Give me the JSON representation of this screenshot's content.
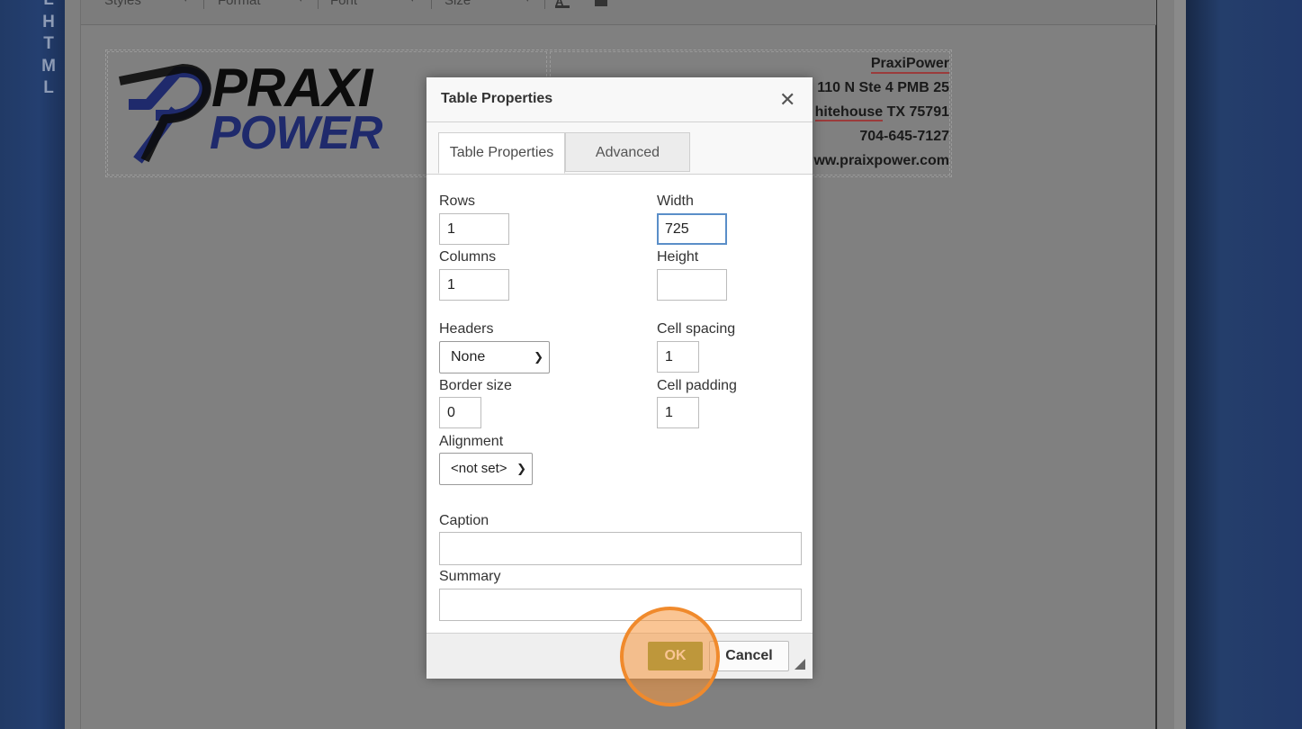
{
  "left_panel": {
    "vertical_label": [
      "L",
      " ",
      "H",
      "T",
      "M",
      "L"
    ]
  },
  "toolbar": {
    "styles_label": "Styles",
    "format_label": "Format",
    "font_label": "Font",
    "size_label": "Size",
    "text_color_icon": "text-color-icon",
    "bg_color_icon": "background-color-icon"
  },
  "document": {
    "logo_top": "PRAXI",
    "logo_bottom": "POWER",
    "company_name": "PraxiPower",
    "address_line": "110 N Ste 4 PMB 25",
    "city_line_city": "hitehouse",
    "city_line_rest": " TX 75791",
    "phone": "704-645-7127",
    "website": "ww.praixpower.com"
  },
  "dialog": {
    "title": "Table Properties",
    "close_icon": "close-icon",
    "tabs": [
      {
        "label": "Table Properties",
        "active": true
      },
      {
        "label": "Advanced",
        "active": false
      }
    ],
    "fields": {
      "rows_label": "Rows",
      "rows_value": "1",
      "columns_label": "Columns",
      "columns_value": "1",
      "width_label": "Width",
      "width_value": "725",
      "height_label": "Height",
      "height_value": "",
      "headers_label": "Headers",
      "headers_value": "None",
      "cell_spacing_label": "Cell spacing",
      "cell_spacing_value": "1",
      "border_size_label": "Border size",
      "border_size_value": "0",
      "cell_padding_label": "Cell padding",
      "cell_padding_value": "1",
      "alignment_label": "Alignment",
      "alignment_value": "<not set>",
      "caption_label": "Caption",
      "caption_value": "",
      "summary_label": "Summary",
      "summary_value": ""
    },
    "footer": {
      "ok_label": "OK",
      "cancel_label": "Cancel"
    }
  },
  "colors": {
    "ok_button": "#7a9a3a",
    "click_highlight": "#f08a2c",
    "focus_border": "#5a8ec8"
  }
}
